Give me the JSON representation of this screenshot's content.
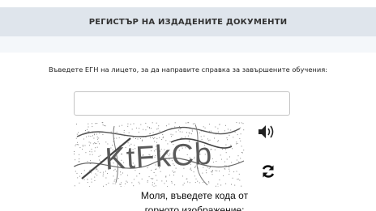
{
  "header": {
    "title": "РЕГИСТЪР НА ИЗДАДЕНИТЕ ДОКУМЕНТИ"
  },
  "form": {
    "instruction": "Въведете ЕГН на лицето, за да направите справка за завършените обучения:",
    "egn_input_value": "",
    "egn_input_placeholder": ""
  },
  "captcha": {
    "text": "KtFkCb",
    "audio_icon": "speaker-icon",
    "refresh_icon": "refresh-icon",
    "caption": "Моля, въведете кода от горното изображение:"
  }
}
